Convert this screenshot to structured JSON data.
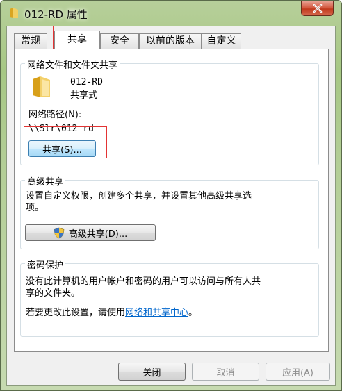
{
  "window": {
    "title": "012-RD 属性"
  },
  "tabs": [
    {
      "label": "常规"
    },
    {
      "label": "共享"
    },
    {
      "label": "安全"
    },
    {
      "label": "以前的版本"
    },
    {
      "label": "自定义"
    }
  ],
  "network_share": {
    "group_label": "网络文件和文件夹共享",
    "folder_name": "012-RD",
    "folder_status": "共享式",
    "path_label": "网络路径(N):",
    "path_value": "\\\\Slr\\012 rd",
    "share_button": "共享(S)..."
  },
  "advanced_share": {
    "group_label": "高级共享",
    "description": "设置自定义权限，创建多个共享，并设置其他高级共享选项。",
    "description_line1": "设置自定义权限，创建多个共享，并设置其他高级共享选",
    "description_line2": "项。",
    "button": "高级共享(D)..."
  },
  "password_protection": {
    "group_label": "密码保护",
    "line1": "没有此计算机的用户帐户和密码的用户可以访问与所有人共",
    "line2": "享的文件夹。",
    "change_prefix": "若要更改此设置，请使用",
    "link": "网络和共享中心",
    "change_suffix": "。"
  },
  "footer": {
    "close": "关闭",
    "cancel": "取消",
    "apply": "应用(A)"
  },
  "colors": {
    "accent_link": "#0066cc",
    "annotation_red": "#e33434",
    "close_button_red": "#c1391c"
  }
}
